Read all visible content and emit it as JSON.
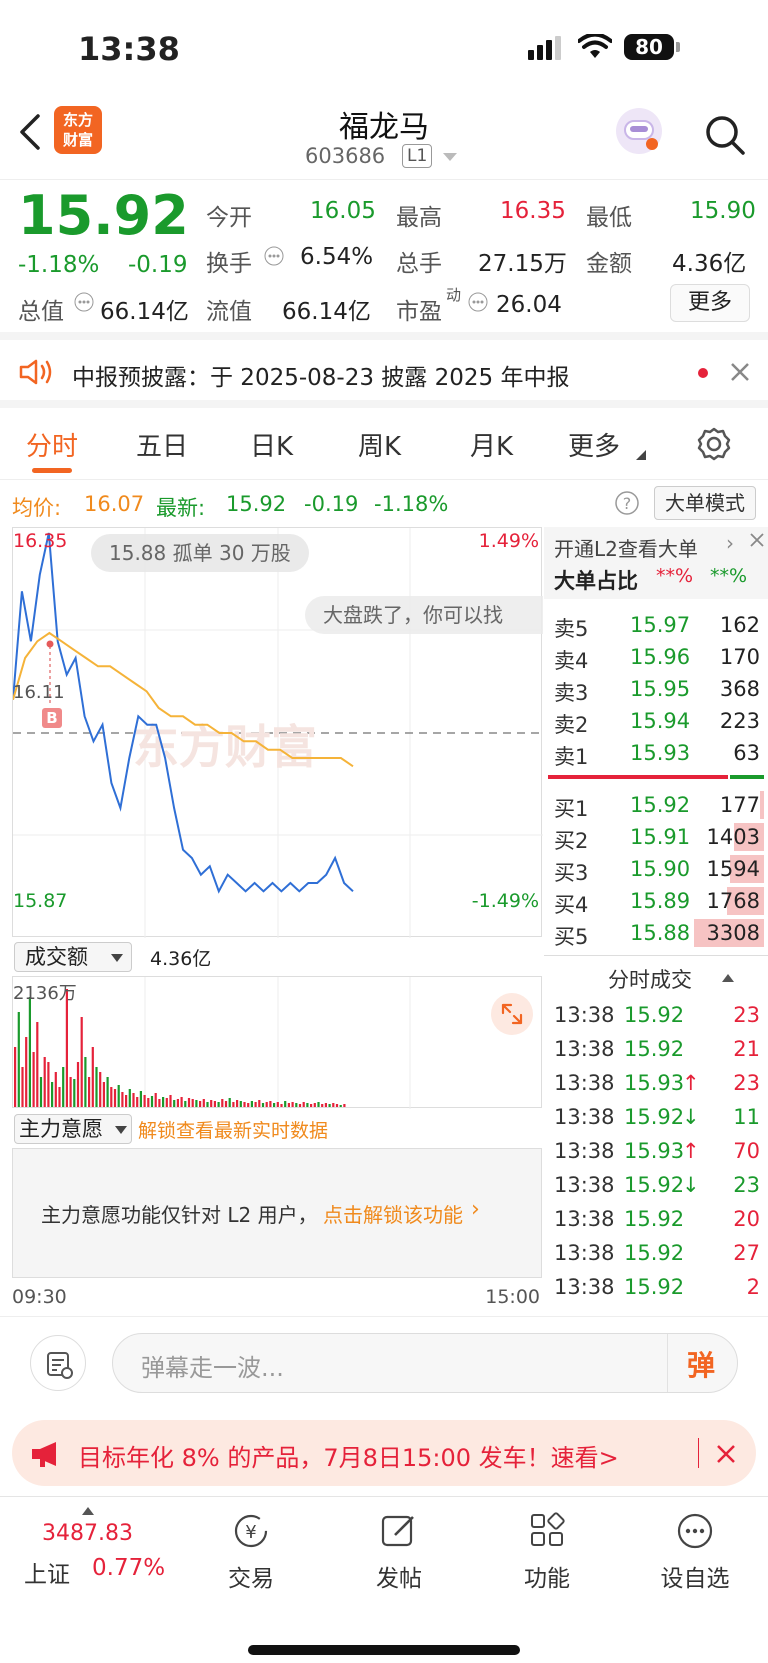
{
  "status": {
    "time": "13:38",
    "battery": "80"
  },
  "nav": {
    "logo_line1": "东方",
    "logo_line2": "财富",
    "title": "福龙马",
    "code": "603686",
    "level": "L1"
  },
  "quote": {
    "price": "15.92",
    "pct": "-1.18%",
    "chg": "-0.19",
    "open_label": "今开",
    "open": "16.05",
    "high_label": "最高",
    "high": "16.35",
    "low_label": "最低",
    "low": "15.90",
    "turnover_label": "换手",
    "turnover": "6.54%",
    "volume_label": "总手",
    "volume": "27.15万",
    "amount_label": "金额",
    "amount": "4.36亿",
    "mktcap_label": "总值",
    "mktcap": "66.14亿",
    "float_label": "流值",
    "float": "66.14亿",
    "pe_label": "市盈",
    "pe_sup": "动",
    "pe": "26.04",
    "more": "更多"
  },
  "notice": {
    "text": "中报预披露：于 2025-08-23 披露 2025 年中报"
  },
  "tabs": [
    "分时",
    "五日",
    "日K",
    "周K",
    "月K",
    "更多"
  ],
  "avg": {
    "avg_label": "均价:",
    "avg": "16.07",
    "new_label": "最新:",
    "new": "15.92",
    "chg": "-0.19",
    "pct": "-1.18%",
    "mode": "大单模式"
  },
  "chart": {
    "top_price": "16.35",
    "bottom_price": "15.87",
    "mid_price": "16.11",
    "top_pct": "1.49%",
    "bottom_pct": "-1.49%",
    "bubble1": "15.88 孤单 30 万股",
    "bubble2": "大盘跌了，你可以找",
    "watermark": "东方财富",
    "marker": "B"
  },
  "chart_data": {
    "type": "line",
    "ylim": [
      15.87,
      16.35
    ],
    "series": [
      {
        "values": [
          16.15,
          16.28,
          16.22,
          16.3,
          16.35,
          16.22,
          16.18,
          16.2,
          16.13,
          16.1,
          16.12,
          16.05,
          16.02,
          16.08,
          16.13,
          16.12,
          16.12,
          16.08,
          16.02,
          15.97,
          15.96,
          15.94,
          15.95,
          15.92,
          15.94,
          15.93,
          15.92,
          15.93,
          15.92,
          15.93,
          15.92,
          15.93,
          15.92,
          15.93,
          15.93,
          15.94,
          15.96,
          15.93,
          15.92
        ]
      },
      {
        "values": [
          16.15,
          16.2,
          16.22,
          16.23,
          16.22,
          16.21,
          16.2,
          16.19,
          16.19,
          16.18,
          16.17,
          16.16,
          16.14,
          16.13,
          16.13,
          16.12,
          16.12,
          16.11,
          16.11,
          16.1,
          16.1,
          16.09,
          16.09,
          16.08,
          16.08,
          16.08,
          16.08,
          16.08,
          16.07
        ]
      }
    ]
  },
  "orderbook": {
    "header": "开通L2查看大单",
    "ratio_label": "大单占比",
    "ratio_sell": "**%",
    "ratio_buy": "**%",
    "sells": [
      {
        "label": "卖5",
        "price": "15.97",
        "vol": "162"
      },
      {
        "label": "卖4",
        "price": "15.96",
        "vol": "170"
      },
      {
        "label": "卖3",
        "price": "15.95",
        "vol": "368"
      },
      {
        "label": "卖2",
        "price": "15.94",
        "vol": "223"
      },
      {
        "label": "卖1",
        "price": "15.93",
        "vol": "63"
      }
    ],
    "buys": [
      {
        "label": "买1",
        "price": "15.92",
        "vol": "177"
      },
      {
        "label": "买2",
        "price": "15.91",
        "vol": "1403"
      },
      {
        "label": "买3",
        "price": "15.90",
        "vol": "1594"
      },
      {
        "label": "买4",
        "price": "15.89",
        "vol": "1768"
      },
      {
        "label": "买5",
        "price": "15.88",
        "vol": "3308"
      }
    ],
    "ticks_title": "分时成交",
    "ticks": [
      {
        "time": "13:38",
        "price": "15.92",
        "vol": "23",
        "dir": ""
      },
      {
        "time": "13:38",
        "price": "15.92",
        "vol": "21",
        "dir": ""
      },
      {
        "time": "13:38",
        "price": "15.93",
        "vol": "23",
        "dir": "↑"
      },
      {
        "time": "13:38",
        "price": "15.92",
        "vol": "11",
        "dir": "↓"
      },
      {
        "time": "13:38",
        "price": "15.93",
        "vol": "70",
        "dir": "↑"
      },
      {
        "time": "13:38",
        "price": "15.92",
        "vol": "23",
        "dir": "↓"
      },
      {
        "time": "13:38",
        "price": "15.92",
        "vol": "20",
        "dir": ""
      },
      {
        "time": "13:38",
        "price": "15.92",
        "vol": "27",
        "dir": ""
      },
      {
        "time": "13:38",
        "price": "15.92",
        "vol": "2",
        "dir": ""
      }
    ]
  },
  "volume": {
    "label": "成交额",
    "total": "4.36亿",
    "max": "2136万"
  },
  "zhuli": {
    "label": "主力意愿",
    "unlock": "解锁查看最新实时数据",
    "msg": "主力意愿功能仅针对 L2 用户，",
    "link": "点击解锁该功能"
  },
  "times": {
    "start": "09:30",
    "end": "15:00"
  },
  "danmu": {
    "placeholder": "弹幕走一波...",
    "send": "弹"
  },
  "promo": {
    "text": "目标年化 8% 的产品，7月8日15:00 发车！速看>"
  },
  "bottom": {
    "index_value": "3487.83",
    "index_name": "上证",
    "index_pct": "0.77%",
    "items": [
      "交易",
      "发帖",
      "功能",
      "设自选"
    ]
  }
}
